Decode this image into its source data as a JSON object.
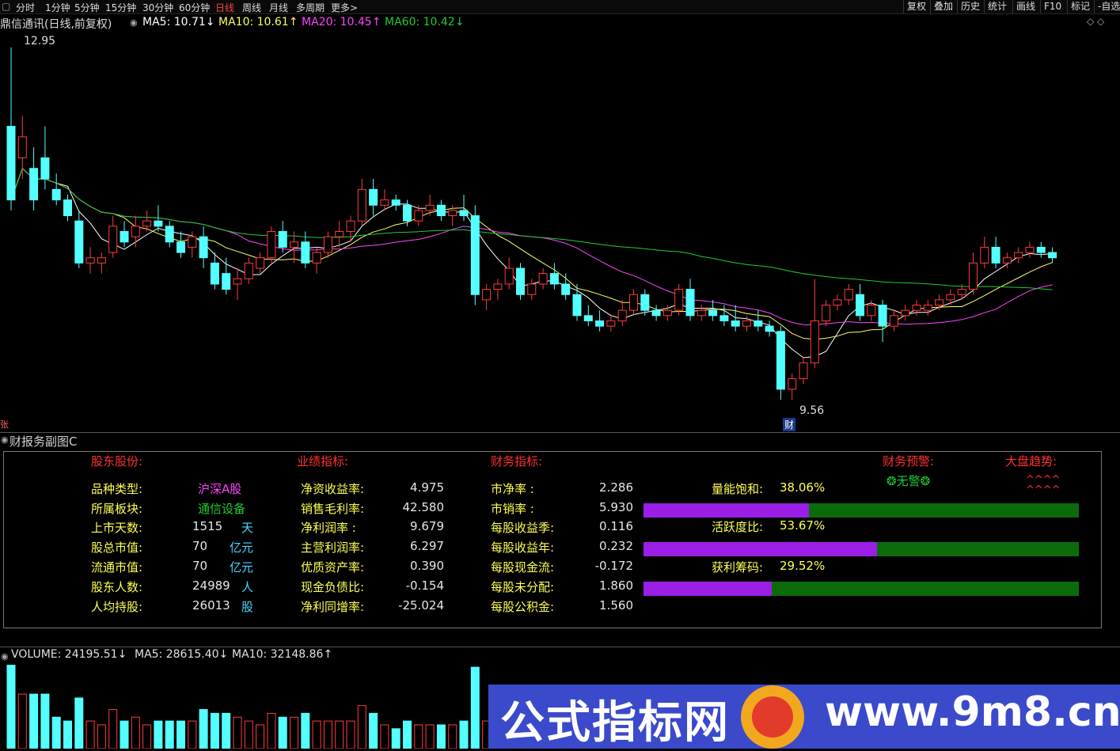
{
  "toolbar": {
    "left_icon": "▢",
    "periods": [
      "分时",
      "1分钟",
      "5分钟",
      "15分钟",
      "30分钟",
      "60分钟",
      "日线",
      "周线",
      "月线",
      "多周期",
      "更多>"
    ],
    "active_period": "日线",
    "right_buttons": [
      "复权",
      "叠加",
      "历史",
      "统计",
      "画线",
      "F10",
      "标记",
      "-自选"
    ]
  },
  "header": {
    "stock_title": "鼎信通讯(日线,前复权)",
    "ma5": "MA5: 10.71↓",
    "ma10": "MA10: 10.61↑",
    "ma20": "MA20: 10.45↑",
    "ma60": "MA60: 10.42↓",
    "right_icons": "◇ ◇"
  },
  "colors": {
    "up": "#ff3b3b",
    "down": "#54ffff",
    "ma5": "#ffffff",
    "ma10": "#ffff66",
    "ma20": "#ff44ff",
    "ma60": "#22cc33",
    "bar_fill": "#9a1ee6",
    "bar_bg": "#0b6b0b"
  },
  "price_labels": {
    "high": "12.95",
    "low": "9.56",
    "marker_cai": "财",
    "marker_left": "张"
  },
  "chart_data": {
    "type": "candlestick",
    "price_range": [
      9.3,
      13.1
    ],
    "high_label": 12.95,
    "low_label": 9.56,
    "ohlc": [
      [
        12.2,
        12.95,
        11.4,
        11.5
      ],
      [
        11.9,
        12.3,
        11.7,
        12.1
      ],
      [
        11.8,
        12.0,
        11.4,
        11.5
      ],
      [
        11.9,
        12.2,
        11.6,
        11.7
      ],
      [
        11.6,
        11.75,
        11.45,
        11.5
      ],
      [
        11.5,
        11.55,
        11.3,
        11.35
      ],
      [
        11.3,
        11.4,
        10.85,
        10.9
      ],
      [
        10.9,
        11.05,
        10.8,
        10.95
      ],
      [
        10.9,
        11.0,
        10.8,
        10.95
      ],
      [
        11.0,
        11.35,
        10.95,
        11.25
      ],
      [
        11.2,
        11.3,
        11.05,
        11.1
      ],
      [
        11.15,
        11.35,
        11.05,
        11.25
      ],
      [
        11.25,
        11.4,
        11.2,
        11.3
      ],
      [
        11.3,
        11.45,
        11.2,
        11.25
      ],
      [
        11.25,
        11.3,
        11.05,
        11.1
      ],
      [
        11.1,
        11.2,
        10.95,
        11.0
      ],
      [
        11.05,
        11.2,
        10.95,
        11.15
      ],
      [
        11.15,
        11.25,
        10.85,
        10.95
      ],
      [
        10.9,
        11.0,
        10.65,
        10.7
      ],
      [
        10.8,
        10.95,
        10.6,
        10.65
      ],
      [
        10.7,
        10.85,
        10.55,
        10.75
      ],
      [
        10.75,
        10.95,
        10.7,
        10.9
      ],
      [
        10.85,
        11.0,
        10.8,
        10.95
      ],
      [
        10.95,
        11.25,
        10.9,
        11.2
      ],
      [
        11.2,
        11.3,
        11.0,
        11.05
      ],
      [
        11.05,
        11.2,
        10.9,
        11.1
      ],
      [
        11.1,
        11.2,
        10.85,
        10.9
      ],
      [
        10.9,
        11.05,
        10.8,
        11.0
      ],
      [
        11.0,
        11.2,
        10.95,
        11.15
      ],
      [
        11.15,
        11.3,
        11.05,
        11.2
      ],
      [
        11.2,
        11.35,
        11.1,
        11.3
      ],
      [
        11.3,
        11.7,
        11.25,
        11.6
      ],
      [
        11.6,
        11.7,
        11.35,
        11.45
      ],
      [
        11.45,
        11.6,
        11.4,
        11.5
      ],
      [
        11.5,
        11.55,
        11.4,
        11.45
      ],
      [
        11.45,
        11.5,
        11.25,
        11.3
      ],
      [
        11.3,
        11.45,
        11.25,
        11.4
      ],
      [
        11.4,
        11.55,
        11.35,
        11.45
      ],
      [
        11.45,
        11.5,
        11.3,
        11.35
      ],
      [
        11.35,
        11.45,
        11.25,
        11.4
      ],
      [
        11.4,
        11.55,
        11.3,
        11.35
      ],
      [
        11.35,
        11.45,
        10.5,
        10.6
      ],
      [
        10.55,
        10.7,
        10.45,
        10.65
      ],
      [
        10.65,
        10.75,
        10.55,
        10.7
      ],
      [
        10.7,
        10.95,
        10.65,
        10.85
      ],
      [
        10.85,
        10.9,
        10.55,
        10.6
      ],
      [
        10.6,
        10.75,
        10.55,
        10.7
      ],
      [
        10.7,
        10.85,
        10.65,
        10.8
      ],
      [
        10.8,
        10.9,
        10.65,
        10.7
      ],
      [
        10.7,
        10.8,
        10.55,
        10.6
      ],
      [
        10.6,
        10.7,
        10.35,
        10.4
      ],
      [
        10.4,
        10.5,
        10.3,
        10.35
      ],
      [
        10.35,
        10.45,
        10.25,
        10.3
      ],
      [
        10.3,
        10.4,
        10.25,
        10.35
      ],
      [
        10.35,
        10.55,
        10.3,
        10.45
      ],
      [
        10.45,
        10.65,
        10.4,
        10.6
      ],
      [
        10.6,
        10.65,
        10.4,
        10.45
      ],
      [
        10.45,
        10.5,
        10.35,
        10.4
      ],
      [
        10.4,
        10.5,
        10.35,
        10.45
      ],
      [
        10.45,
        10.7,
        10.4,
        10.65
      ],
      [
        10.65,
        10.75,
        10.35,
        10.4
      ],
      [
        10.4,
        10.5,
        10.35,
        10.45
      ],
      [
        10.45,
        10.55,
        10.35,
        10.4
      ],
      [
        10.4,
        10.5,
        10.3,
        10.35
      ],
      [
        10.35,
        10.5,
        10.25,
        10.3
      ],
      [
        10.3,
        10.4,
        10.25,
        10.35
      ],
      [
        10.35,
        10.45,
        10.25,
        10.3
      ],
      [
        10.3,
        10.35,
        10.2,
        10.25
      ],
      [
        10.25,
        10.3,
        9.6,
        9.7
      ],
      [
        9.7,
        9.85,
        9.6,
        9.8
      ],
      [
        9.8,
        10.0,
        9.75,
        9.95
      ],
      [
        9.95,
        10.75,
        9.9,
        10.35
      ],
      [
        10.35,
        10.55,
        10.3,
        10.5
      ],
      [
        10.5,
        10.6,
        10.45,
        10.55
      ],
      [
        10.55,
        10.7,
        10.5,
        10.65
      ],
      [
        10.6,
        10.7,
        10.35,
        10.4
      ],
      [
        10.4,
        10.55,
        10.35,
        10.5
      ],
      [
        10.5,
        10.55,
        10.15,
        10.3
      ],
      [
        10.3,
        10.45,
        10.25,
        10.4
      ],
      [
        10.4,
        10.5,
        10.35,
        10.45
      ],
      [
        10.45,
        10.55,
        10.4,
        10.5
      ],
      [
        10.45,
        10.55,
        10.4,
        10.5
      ],
      [
        10.5,
        10.6,
        10.45,
        10.55
      ],
      [
        10.55,
        10.65,
        10.5,
        10.6
      ],
      [
        10.6,
        10.7,
        10.55,
        10.65
      ],
      [
        10.65,
        11.0,
        10.6,
        10.9
      ],
      [
        10.9,
        11.15,
        10.85,
        11.05
      ],
      [
        11.05,
        11.15,
        10.85,
        10.9
      ],
      [
        10.9,
        11.0,
        10.85,
        10.95
      ],
      [
        10.95,
        11.05,
        10.9,
        11.0
      ],
      [
        11.0,
        11.1,
        10.95,
        11.05
      ],
      [
        11.05,
        11.1,
        10.95,
        11.0
      ],
      [
        11.0,
        11.05,
        10.9,
        10.95
      ]
    ],
    "volume": {
      "label": "VOLUME: 24195.51↓",
      "ma5": "MA5: 28615.40↓",
      "ma10": "MA10: 32148.86↑",
      "range": [
        0,
        120000
      ]
    }
  },
  "panel": {
    "title": "财报务副图C",
    "sections": {
      "holder": "股东股份:",
      "perf": "业绩指标:",
      "fin": "财务指标:",
      "warn": "财务预警:",
      "trend": "大盘趋势:"
    },
    "holder_rows": [
      {
        "label": "品种类型:",
        "value": "沪深A股",
        "unit": ""
      },
      {
        "label": "所属板块:",
        "value": "通信设备",
        "unit": ""
      },
      {
        "label": "上市天数:",
        "value": "1515",
        "unit": "天"
      },
      {
        "label": "股总市值:",
        "value": "70",
        "unit": "亿元"
      },
      {
        "label": "流通市值:",
        "value": "70",
        "unit": "亿元"
      },
      {
        "label": "股东人数:",
        "value": "24989",
        "unit": "人"
      },
      {
        "label": "人均持股:",
        "value": "26013",
        "unit": "股"
      }
    ],
    "perf_rows": [
      {
        "label": "净资收益率:",
        "value": "4.975"
      },
      {
        "label": "销售毛利率:",
        "value": "42.580"
      },
      {
        "label": "净利润率 :",
        "value": "9.679"
      },
      {
        "label": "主营利润率:",
        "value": "6.297"
      },
      {
        "label": "优质资产率:",
        "value": "0.390"
      },
      {
        "label": "现金负债比:",
        "value": "-0.154"
      },
      {
        "label": "净利同增率:",
        "value": "-25.024"
      }
    ],
    "fin_rows": [
      {
        "label": "市净率 :",
        "value": "2.286"
      },
      {
        "label": "市销率 :",
        "value": "5.930"
      },
      {
        "label": "每股收益季:",
        "value": "0.116"
      },
      {
        "label": "每股收益年:",
        "value": "0.232"
      },
      {
        "label": "每股现金流:",
        "value": "-0.172"
      },
      {
        "label": "每股未分配:",
        "value": "1.860"
      },
      {
        "label": "每股公积金:",
        "value": "1.560"
      }
    ],
    "warn_value": "❂无警❂",
    "trend_value": "^^^^",
    "trend_value2": "^^^^",
    "gauges": [
      {
        "label": "量能饱和:",
        "value": "38.06%",
        "fraction": 0.3806
      },
      {
        "label": "活跃度比:",
        "value": "53.67%",
        "fraction": 0.5367
      },
      {
        "label": "获利筹码:",
        "value": "29.52%",
        "fraction": 0.2952
      }
    ]
  },
  "watermark": {
    "title": "公式指标网",
    "url": "www.9m8.cn"
  }
}
